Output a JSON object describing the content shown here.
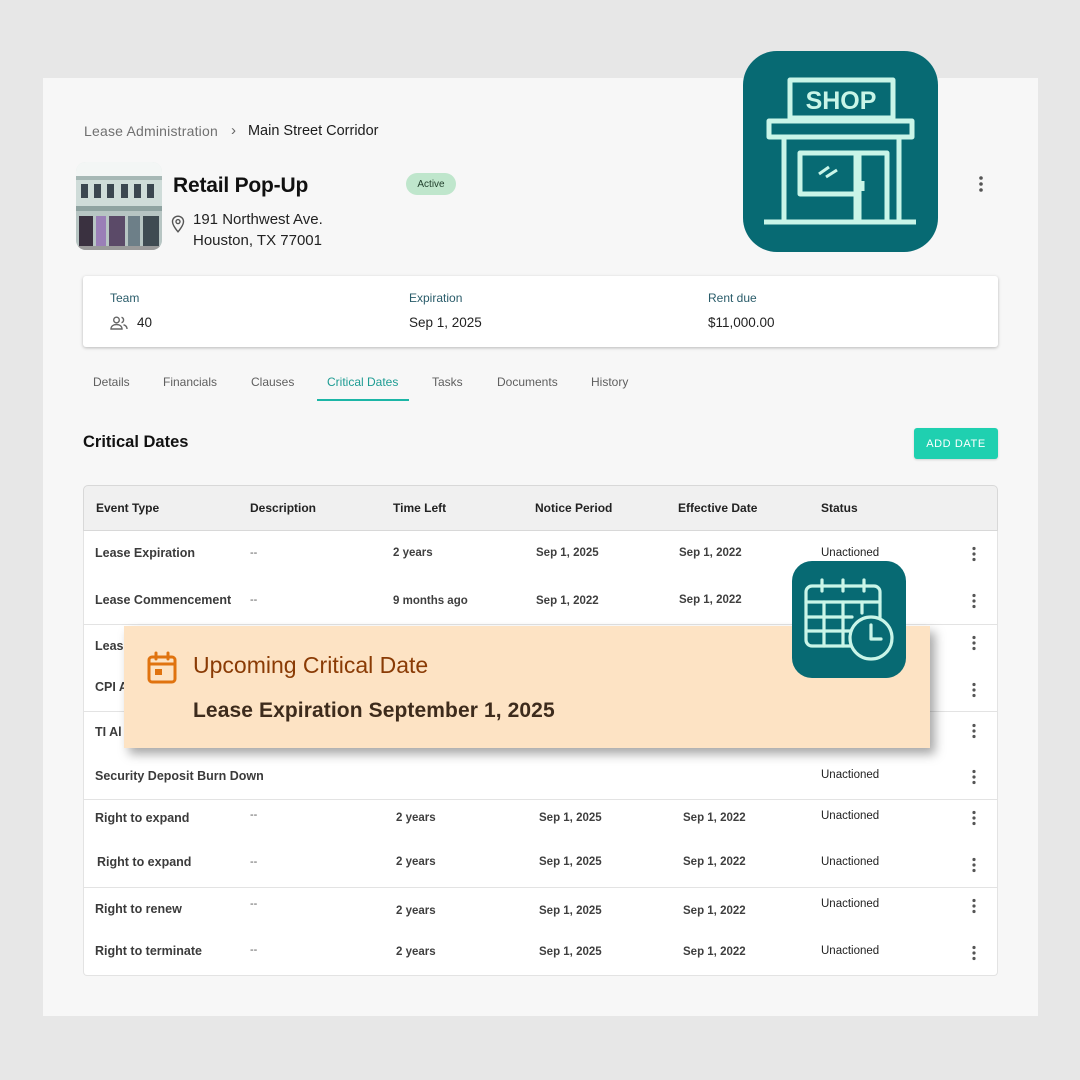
{
  "breadcrumb": {
    "parent": "Lease Administration",
    "separator": "›",
    "current": "Main Street Corridor"
  },
  "property": {
    "name": "Retail Pop-Up",
    "address_line1": "191 Northwest Ave.",
    "address_line2": "Houston, TX 77001",
    "status": "Active"
  },
  "shop_graphic": {
    "sign_text": "SHOP",
    "icon": "storefront-icon"
  },
  "summary": {
    "team_label": "Team",
    "team_value": "40",
    "team_icon": "people-icon",
    "expiration_label": "Expiration",
    "expiration_value": "Sep 1, 2025",
    "rent_label": "Rent due",
    "rent_value": "$11,000.00"
  },
  "tabs": [
    {
      "label": "Details"
    },
    {
      "label": "Financials"
    },
    {
      "label": "Clauses"
    },
    {
      "label": "Critical Dates",
      "active": true
    },
    {
      "label": "Tasks"
    },
    {
      "label": "Documents"
    },
    {
      "label": "History"
    }
  ],
  "section": {
    "title": "Critical Dates",
    "add_button": "ADD DATE"
  },
  "table": {
    "columns": [
      "Event Type",
      "Description",
      "Time Left",
      "Notice Period",
      "Effective Date",
      "Status"
    ],
    "rows": [
      {
        "event": "Lease Expiration",
        "description": "--",
        "time_left": "2 years",
        "notice": "Sep 1, 2025",
        "effective": "Sep 1, 2022",
        "status": "Unactioned"
      },
      {
        "event": "Lease Commencement",
        "description": "--",
        "time_left": "9 months ago",
        "notice": "Sep 1, 2022",
        "effective": "Sep 1, 2022",
        "status": ""
      },
      {
        "event": "Leas",
        "description": "",
        "time_left": "",
        "notice": "",
        "effective": "",
        "status": ""
      },
      {
        "event": "CPI A",
        "description": "",
        "time_left": "",
        "notice": "",
        "effective": "",
        "status": ""
      },
      {
        "event": "TI Al",
        "description": "",
        "time_left": "",
        "notice": "",
        "effective": "",
        "status": ""
      },
      {
        "event": "Security Deposit Burn Down",
        "description": "",
        "time_left": "",
        "notice": "",
        "effective": "",
        "status": "Unactioned"
      },
      {
        "event": "Right to expand",
        "description": "--",
        "time_left": "2 years",
        "notice": "Sep 1, 2025",
        "effective": "Sep 1, 2022",
        "status": "Unactioned"
      },
      {
        "event": "Right to expand",
        "description": "--",
        "time_left": "2 years",
        "notice": "Sep 1, 2025",
        "effective": "Sep 1, 2022",
        "status": "Unactioned"
      },
      {
        "event": "Right to renew",
        "description": "--",
        "time_left": "2 years",
        "notice": "Sep 1, 2025",
        "effective": "Sep 1, 2022",
        "status": "Unactioned"
      },
      {
        "event": "Right to terminate",
        "description": "--",
        "time_left": "2 years",
        "notice": "Sep 1, 2025",
        "effective": "Sep 1, 2022",
        "status": "Unactioned"
      }
    ]
  },
  "alert": {
    "title": "Upcoming Critical Date",
    "body": "Lease Expiration September 1, 2025",
    "icon": "calendar-icon"
  },
  "calendar_graphic": {
    "icon": "calendar-clock-icon"
  },
  "colors": {
    "teal_tile": "#076a73",
    "accent": "#1fd0b0",
    "alert_bg": "#fde3c4",
    "alert_title": "#8a3b05"
  }
}
